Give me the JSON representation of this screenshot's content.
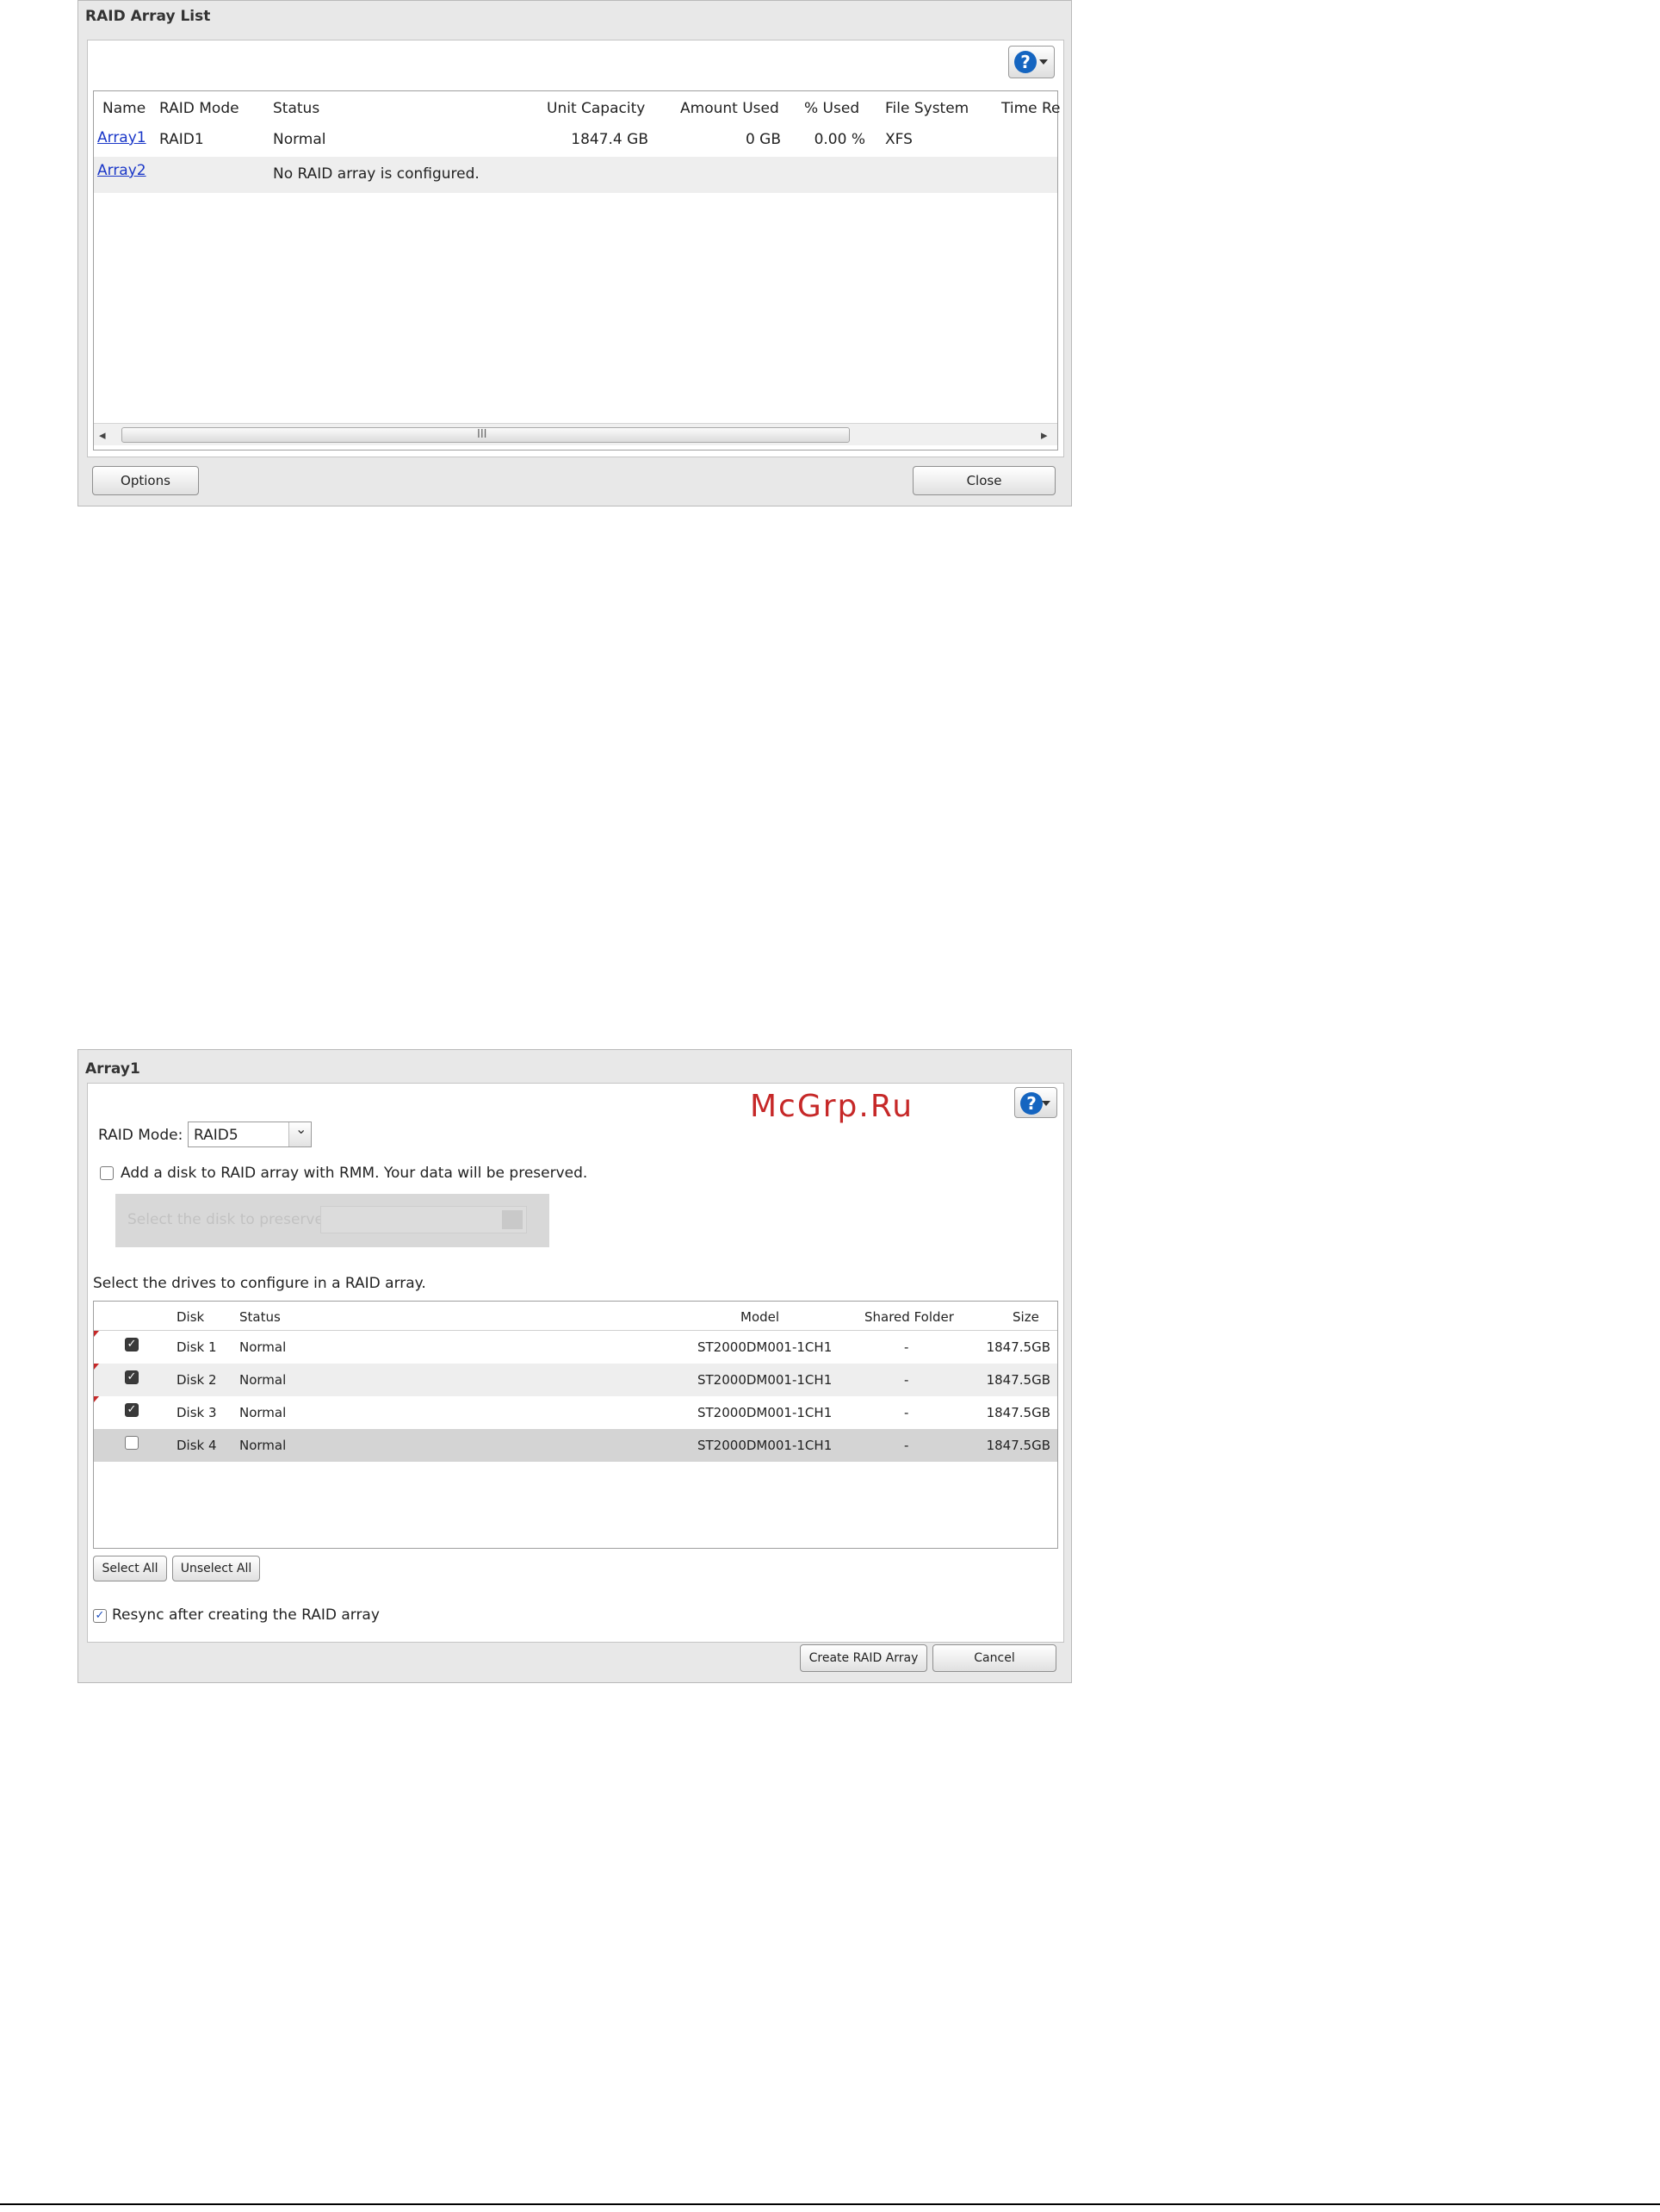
{
  "raid_list": {
    "title": "RAID Array List",
    "columns": [
      "Name",
      "RAID Mode",
      "Status",
      "Unit Capacity",
      "Amount Used",
      "% Used",
      "File System",
      "Time Re"
    ],
    "rows": [
      {
        "name": "Array1",
        "mode": "RAID1",
        "status": "Normal",
        "capacity": "1847.4 GB",
        "used": "0 GB",
        "pct": "0.00 %",
        "fs": "XFS"
      },
      {
        "name": "Array2",
        "mode": "",
        "status": "No RAID array is configured.",
        "capacity": "",
        "used": "",
        "pct": "",
        "fs": ""
      }
    ],
    "scroll_grip": "III",
    "options_label": "Options",
    "close_label": "Close"
  },
  "array1": {
    "title": "Array1",
    "watermark": "McGrp.Ru",
    "raid_mode_label": "RAID Mode:",
    "raid_mode_value": "RAID5",
    "rmm_label": "Add a disk to RAID array with RMM. Your data will be preserved.",
    "preserve_label": "Select the disk to preserve:",
    "select_drives_label": "Select the drives to configure in a RAID array.",
    "columns": [
      "Disk",
      "Status",
      "Model",
      "Shared Folder",
      "Size"
    ],
    "disks": [
      {
        "disk": "Disk 1",
        "status": "Normal",
        "model": "ST2000DM001-1CH1",
        "folder": "-",
        "size": "1847.5GB",
        "checked": true
      },
      {
        "disk": "Disk 2",
        "status": "Normal",
        "model": "ST2000DM001-1CH1",
        "folder": "-",
        "size": "1847.5GB",
        "checked": true
      },
      {
        "disk": "Disk 3",
        "status": "Normal",
        "model": "ST2000DM001-1CH1",
        "folder": "-",
        "size": "1847.5GB",
        "checked": true
      },
      {
        "disk": "Disk 4",
        "status": "Normal",
        "model": "ST2000DM001-1CH1",
        "folder": "-",
        "size": "1847.5GB",
        "checked": false
      }
    ],
    "select_all_label": "Select All",
    "unselect_all_label": "Unselect All",
    "resync_label": "Resync after creating the RAID array",
    "create_label": "Create RAID Array",
    "cancel_label": "Cancel"
  },
  "icons": {
    "help": "?",
    "check": "✓",
    "dropdown": "⌄",
    "scroll_left": "◂",
    "scroll_right": "▸"
  }
}
